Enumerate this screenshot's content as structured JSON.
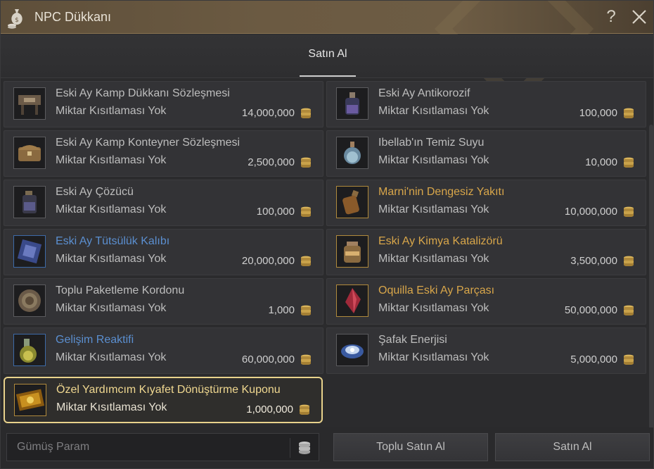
{
  "window": {
    "title": "NPC Dükkanı",
    "help_glyph": "?",
    "icons": {
      "title": "money-bag-icon",
      "help": "question-icon",
      "close": "close-icon"
    }
  },
  "tabs": [
    {
      "label": "Satın Al",
      "active": true
    }
  ],
  "items": [
    {
      "name": "Eski Ay Kamp Dükkanı Sözleşmesi",
      "limit": "Miktar Kısıtlaması Yok",
      "price": "14,000,000",
      "grade": "white",
      "icon": "camp-shop-icon"
    },
    {
      "name": "Eski Ay Antikorozif",
      "limit": "Miktar Kısıtlaması Yok",
      "price": "100,000",
      "grade": "white",
      "icon": "potion-bottle-icon"
    },
    {
      "name": "Eski Ay Kamp Konteyner Sözleşmesi",
      "limit": "Miktar Kısıtlaması Yok",
      "price": "2,500,000",
      "grade": "white",
      "icon": "chest-icon"
    },
    {
      "name": "Ibellab'ın Temiz Suyu",
      "limit": "Miktar Kısıtlaması Yok",
      "price": "10,000",
      "grade": "white",
      "icon": "water-bottle-icon"
    },
    {
      "name": "Eski Ay Çözücü",
      "limit": "Miktar Kısıtlaması Yok",
      "price": "100,000",
      "grade": "white",
      "icon": "solvent-jar-icon"
    },
    {
      "name": "Marni'nin Dengesiz Yakıtı",
      "limit": "Miktar Kısıtlaması Yok",
      "price": "10,000,000",
      "grade": "gold",
      "icon": "fuel-bottle-icon"
    },
    {
      "name": "Eski Ay Tütsülük Kalıbı",
      "limit": "Miktar Kısıtlaması Yok",
      "price": "20,000,000",
      "grade": "blue",
      "icon": "incense-mold-icon"
    },
    {
      "name": "Eski Ay Kimya Katalizörü",
      "limit": "Miktar Kısıtlaması Yok",
      "price": "3,500,000",
      "grade": "gold",
      "icon": "catalyst-jar-icon"
    },
    {
      "name": "Toplu Paketleme Kordonu",
      "limit": "Miktar Kısıtlaması Yok",
      "price": "1,000",
      "grade": "white",
      "icon": "rope-coil-icon"
    },
    {
      "name": "Oquilla Eski Ay Parçası",
      "limit": "Miktar Kısıtlaması Yok",
      "price": "50,000,000",
      "grade": "gold",
      "icon": "crystal-shard-icon"
    },
    {
      "name": "Gelişim Reaktifi",
      "limit": "Miktar Kısıtlaması Yok",
      "price": "60,000,000",
      "grade": "blue",
      "icon": "reagent-flask-icon"
    },
    {
      "name": "Şafak Enerjisi",
      "limit": "Miktar Kısıtlaması Yok",
      "price": "5,000,000",
      "grade": "white",
      "icon": "dawn-energy-icon"
    },
    {
      "name": "Özel Yardımcım Kıyafet Dönüştürme Kuponu",
      "limit": "Miktar Kısıtlaması Yok",
      "price": "1,000,000",
      "grade": "yellow",
      "icon": "coupon-icon",
      "selected": true
    }
  ],
  "footer": {
    "money_placeholder": "Gümüş Param",
    "bulk_buy_label": "Toplu Satın Al",
    "buy_label": "Satın Al"
  },
  "colors": {
    "title_bar": "#6b5a42",
    "selected_border": "#e8d28c",
    "grade_blue": "#5b8fd0",
    "grade_gold": "#d8a64a",
    "grade_yellow": "#f0d890",
    "coin": "#c9a24a"
  }
}
